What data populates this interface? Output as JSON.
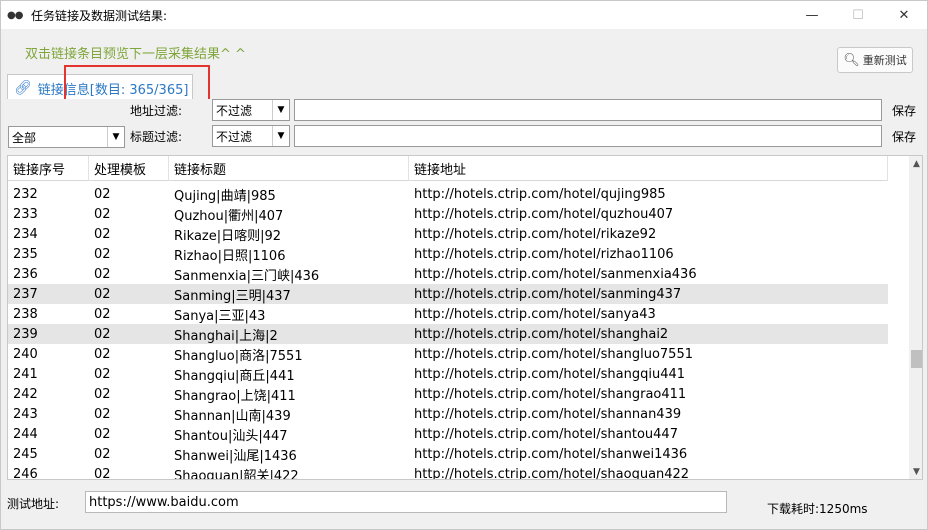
{
  "window": {
    "title": "任务链接及数据测试结果:",
    "minimize": "—",
    "maximize": "☐",
    "close": "✕"
  },
  "hint": "双击链接条目预览下一层采集结果^ ^",
  "retest_button": "重新测试",
  "tab": {
    "label": "链接信息[数目: 365/365]"
  },
  "filters": {
    "category_select": "全部",
    "address_label": "地址过滤:",
    "address_mode": "不过滤",
    "address_value": "",
    "title_label": "标题过滤:",
    "title_mode": "不过滤",
    "title_value": "",
    "save_label_1": "保存",
    "save_label_2": "保存"
  },
  "table": {
    "columns": [
      "链接序号",
      "处理模板",
      "链接标题",
      "链接地址"
    ],
    "rows": [
      {
        "id": "232",
        "template": "02",
        "title": "Qujing|曲靖|985",
        "url": "http://hotels.ctrip.com/hotel/qujing985",
        "selected": false
      },
      {
        "id": "233",
        "template": "02",
        "title": "Quzhou|衢州|407",
        "url": "http://hotels.ctrip.com/hotel/quzhou407",
        "selected": false
      },
      {
        "id": "234",
        "template": "02",
        "title": "Rikaze|日喀则|92",
        "url": "http://hotels.ctrip.com/hotel/rikaze92",
        "selected": false
      },
      {
        "id": "235",
        "template": "02",
        "title": "Rizhao|日照|1106",
        "url": "http://hotels.ctrip.com/hotel/rizhao1106",
        "selected": false
      },
      {
        "id": "236",
        "template": "02",
        "title": "Sanmenxia|三门峡|436",
        "url": "http://hotels.ctrip.com/hotel/sanmenxia436",
        "selected": false
      },
      {
        "id": "237",
        "template": "02",
        "title": "Sanming|三明|437",
        "url": "http://hotels.ctrip.com/hotel/sanming437",
        "selected": true
      },
      {
        "id": "238",
        "template": "02",
        "title": "Sanya|三亚|43",
        "url": "http://hotels.ctrip.com/hotel/sanya43",
        "selected": false
      },
      {
        "id": "239",
        "template": "02",
        "title": "Shanghai|上海|2",
        "url": "http://hotels.ctrip.com/hotel/shanghai2",
        "selected": true
      },
      {
        "id": "240",
        "template": "02",
        "title": "Shangluo|商洛|7551",
        "url": "http://hotels.ctrip.com/hotel/shangluo7551",
        "selected": false
      },
      {
        "id": "241",
        "template": "02",
        "title": "Shangqiu|商丘|441",
        "url": "http://hotels.ctrip.com/hotel/shangqiu441",
        "selected": false
      },
      {
        "id": "242",
        "template": "02",
        "title": "Shangrao|上饶|411",
        "url": "http://hotels.ctrip.com/hotel/shangrao411",
        "selected": false
      },
      {
        "id": "243",
        "template": "02",
        "title": "Shannan|山南|439",
        "url": "http://hotels.ctrip.com/hotel/shannan439",
        "selected": false
      },
      {
        "id": "244",
        "template": "02",
        "title": "Shantou|汕头|447",
        "url": "http://hotels.ctrip.com/hotel/shantou447",
        "selected": false
      },
      {
        "id": "245",
        "template": "02",
        "title": "Shanwei|汕尾|1436",
        "url": "http://hotels.ctrip.com/hotel/shanwei1436",
        "selected": false
      },
      {
        "id": "246",
        "template": "02",
        "title": "Shaoguan|韶关|422",
        "url": "http://hotels.ctrip.com/hotel/shaoguan422",
        "selected": false
      }
    ]
  },
  "bottom": {
    "test_url_label": "测试地址:",
    "test_url_value": "https://www.baidu.com",
    "download_time": "下载耗时:1250ms"
  },
  "colors": {
    "hint": "#7fa63a",
    "tab_text": "#2b78c4",
    "highlight": "#e3342f",
    "selected_row": "#e5e5e5"
  }
}
